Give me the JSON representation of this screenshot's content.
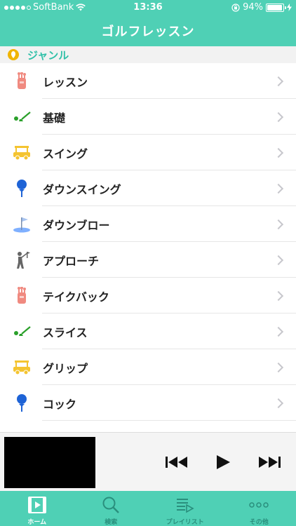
{
  "status_bar": {
    "carrier": "SoftBank",
    "time": "13:36",
    "battery": "94%",
    "battery_level": 0.94,
    "signal_bars": 4
  },
  "nav": {
    "title": "ゴルフレッスン"
  },
  "section": {
    "title": "ジャンル"
  },
  "list": {
    "items": [
      {
        "label": "レッスン",
        "icon": "golf-bag-icon"
      },
      {
        "label": "基礎",
        "icon": "golf-club-ball-icon"
      },
      {
        "label": "スイング",
        "icon": "golf-cart-icon"
      },
      {
        "label": "ダウンスイング",
        "icon": "golf-tee-icon"
      },
      {
        "label": "ダウンブロー",
        "icon": "golf-flag-icon"
      },
      {
        "label": "アプローチ",
        "icon": "golfer-icon"
      },
      {
        "label": "テイクバック",
        "icon": "golf-bag-icon"
      },
      {
        "label": "スライス",
        "icon": "golf-club-ball-icon"
      },
      {
        "label": "グリップ",
        "icon": "golf-cart-icon"
      },
      {
        "label": "コック",
        "icon": "golf-tee-icon"
      }
    ]
  },
  "player": {
    "prev": "skip-previous-icon",
    "play": "play-icon",
    "next": "skip-next-icon"
  },
  "tabs": [
    {
      "label": "ホーム",
      "icon": "film-icon",
      "active": true
    },
    {
      "label": "検索",
      "icon": "search-icon",
      "active": false
    },
    {
      "label": "プレイリスト",
      "icon": "playlist-icon",
      "active": false
    },
    {
      "label": "その他",
      "icon": "more-icon",
      "active": false
    }
  ],
  "colors": {
    "accent": "#4fd0b5",
    "section_title": "#30c0a8",
    "golf_bag": "#f08a80",
    "club_green": "#2aa02a",
    "cart_yellow": "#f4c430",
    "tee_blue": "#1e63d6",
    "flag_blue": "#7fb0ff"
  }
}
